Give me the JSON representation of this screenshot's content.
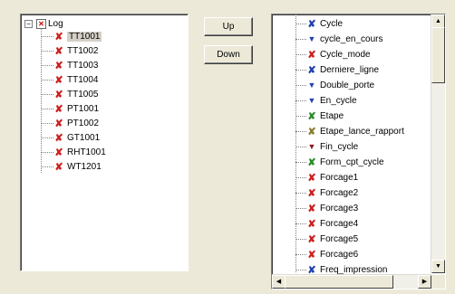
{
  "buttons": {
    "up": "Up",
    "down": "Down"
  },
  "colors": {
    "red": "#cc1f1f",
    "blue": "#2040b0",
    "green": "#2a8a2a",
    "olive": "#8a7a30",
    "dark_red": "#8a1a1a"
  },
  "left_tree": {
    "root": "Log",
    "children": [
      "TT1001",
      "TT1002",
      "TT1003",
      "TT1004",
      "TT1005",
      "PT1001",
      "PT1002",
      "GT1001",
      "RHT1001",
      "WT1201"
    ]
  },
  "right_list": {
    "items": [
      {
        "label": "Cycle",
        "icon": "x-icon",
        "color": "blue"
      },
      {
        "label": "cycle_en_cours",
        "icon": "funnel-icon",
        "color": "blue"
      },
      {
        "label": "Cycle_mode",
        "icon": "x-icon",
        "color": "red"
      },
      {
        "label": "Derniere_ligne",
        "icon": "x-icon",
        "color": "blue"
      },
      {
        "label": "Double_porte",
        "icon": "funnel-icon",
        "color": "blue"
      },
      {
        "label": "En_cycle",
        "icon": "funnel-icon",
        "color": "blue"
      },
      {
        "label": "Etape",
        "icon": "x-icon",
        "color": "green"
      },
      {
        "label": "Etape_lance_rapport",
        "icon": "x-icon",
        "color": "olive"
      },
      {
        "label": "Fin_cycle",
        "icon": "funnel-icon",
        "color": "dark_red"
      },
      {
        "label": "Form_cpt_cycle",
        "icon": "x-icon",
        "color": "green"
      },
      {
        "label": "Forcage1",
        "icon": "x-icon",
        "color": "red"
      },
      {
        "label": "Forcage2",
        "icon": "x-icon",
        "color": "red"
      },
      {
        "label": "Forcage3",
        "icon": "x-icon",
        "color": "red"
      },
      {
        "label": "Forcage4",
        "icon": "x-icon",
        "color": "red"
      },
      {
        "label": "Forcage5",
        "icon": "x-icon",
        "color": "red"
      },
      {
        "label": "Forcage6",
        "icon": "x-icon",
        "color": "red"
      },
      {
        "label": "Freq_impression",
        "icon": "x-icon",
        "color": "blue"
      }
    ]
  }
}
